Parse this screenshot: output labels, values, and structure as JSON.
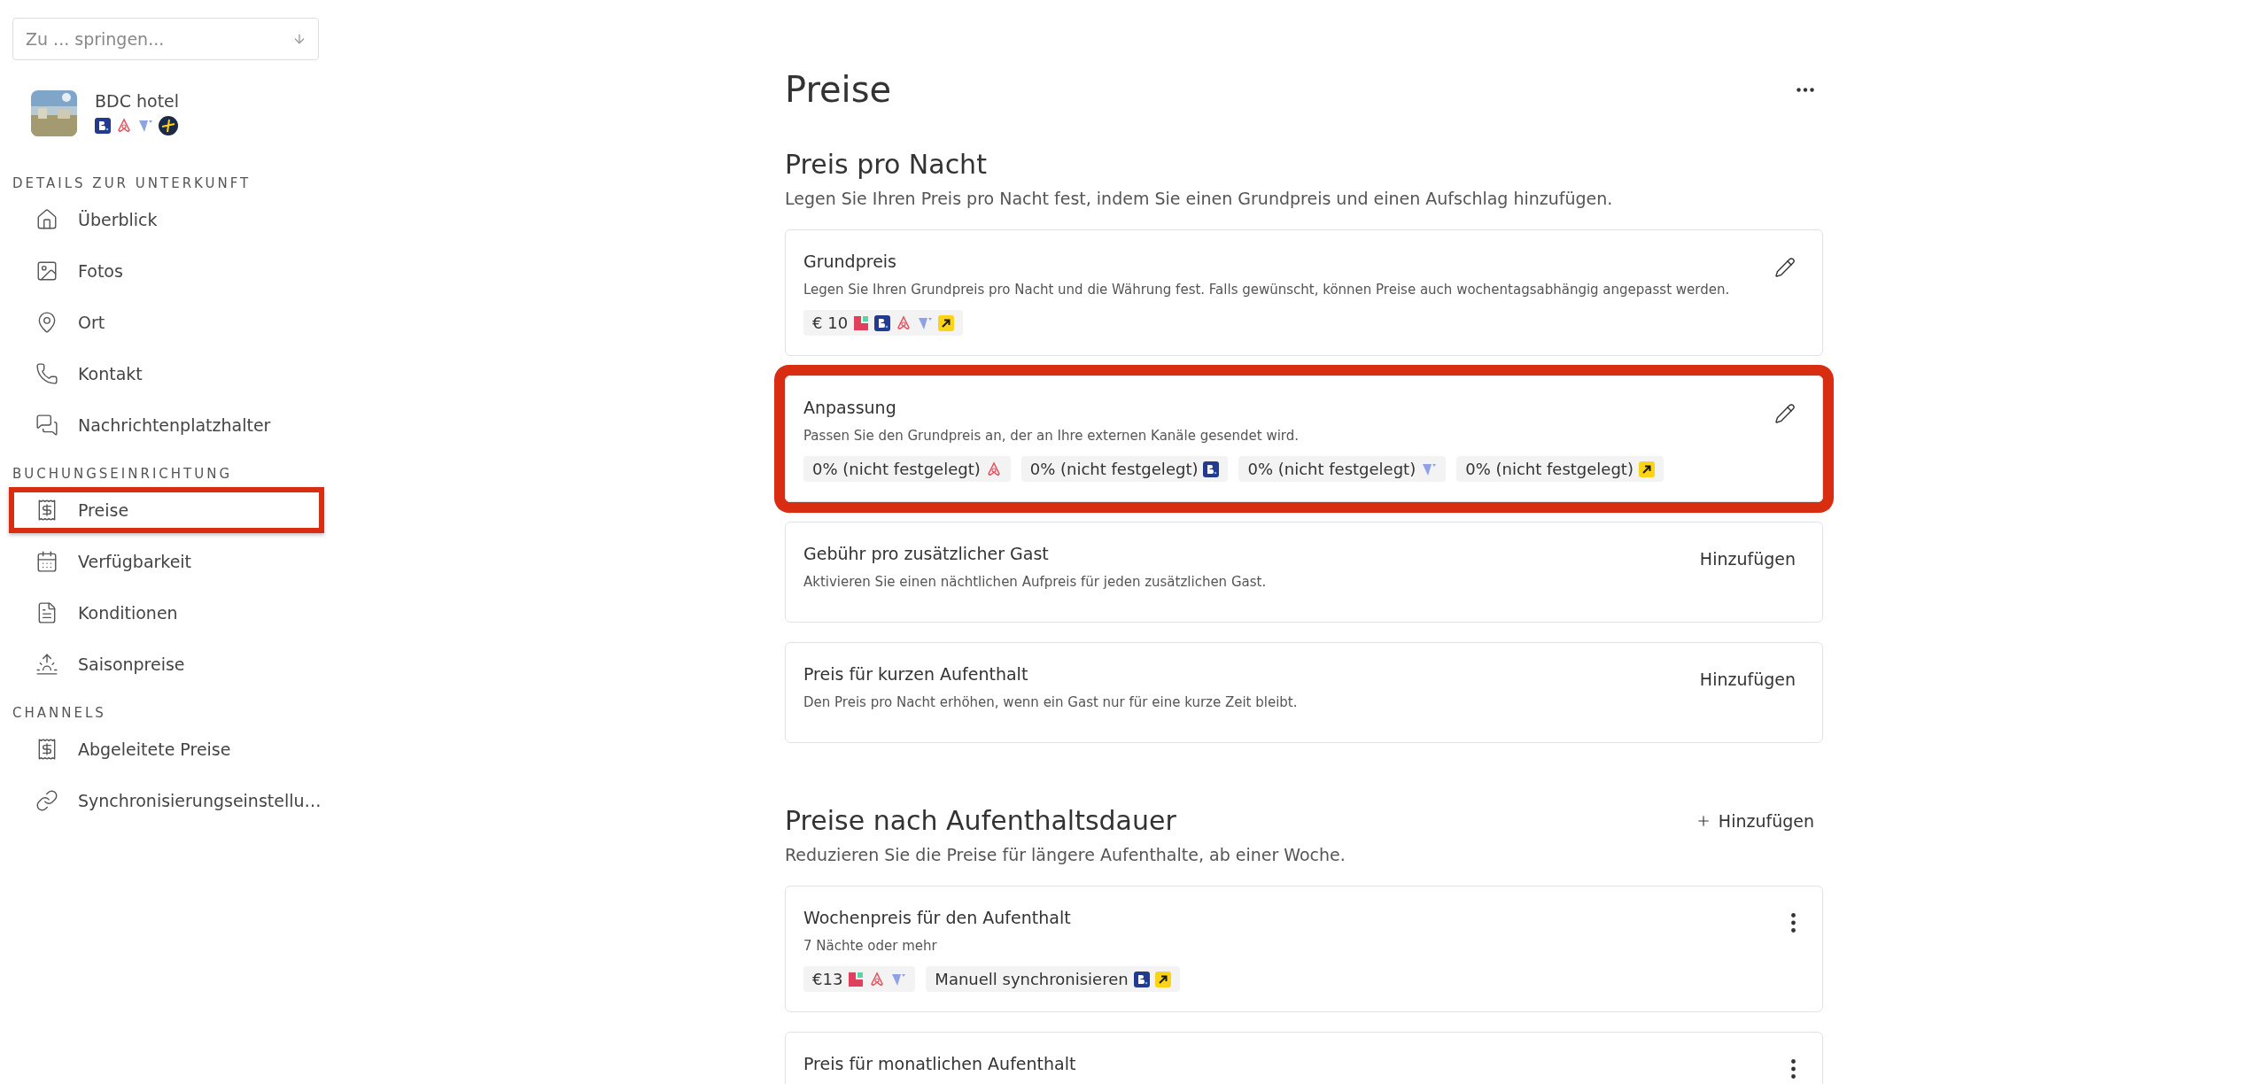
{
  "sidebar": {
    "jump": {
      "placeholder": "Zu ... springen..."
    },
    "property": {
      "name": "BDC hotel",
      "channels": [
        {
          "kind": "booking"
        },
        {
          "kind": "airbnb"
        },
        {
          "kind": "vrbo"
        },
        {
          "kind": "expedia_round"
        }
      ]
    },
    "sections": [
      {
        "title": "DETAILS ZUR UNTERKUNFT",
        "items": [
          {
            "label": "Überblick",
            "highlighted": false
          },
          {
            "label": "Fotos",
            "highlighted": false
          },
          {
            "label": "Ort",
            "highlighted": false
          },
          {
            "label": "Kontakt",
            "highlighted": false
          },
          {
            "label": "Nachrichtenplatzhalter",
            "highlighted": false
          }
        ]
      },
      {
        "title": "BUCHUNGSEINRICHTUNG",
        "items": [
          {
            "label": "Preise",
            "highlighted": true
          },
          {
            "label": "Verfügbarkeit",
            "highlighted": false
          },
          {
            "label": "Konditionen",
            "highlighted": false
          },
          {
            "label": "Saisonpreise",
            "highlighted": false
          }
        ]
      },
      {
        "title": "CHANNELS",
        "items": [
          {
            "label": "Abgeleitete Preise",
            "highlighted": false
          },
          {
            "label": "Synchronisierungseinstellu…",
            "highlighted": false
          }
        ]
      }
    ]
  },
  "page": {
    "title": "Preise",
    "sections": [
      {
        "title": "Preis pro Nacht",
        "description": "Legen Sie Ihren Preis pro Nacht fest, indem Sie einen Grundpreis und einen Aufschlag hinzufügen.",
        "cards": [
          {
            "kind": "edit",
            "title": "Grundpreis",
            "highlighted": false,
            "description": "Legen Sie Ihren Grundpreis pro Nacht und die Währung fest. Falls gewünscht, können Preise auch wochentagsabhängig angepasst werden.",
            "chips": [
              {
                "text": "€ 10",
                "channels": [
                  {
                    "kind": "pms"
                  },
                  {
                    "kind": "booking"
                  },
                  {
                    "kind": "airbnb"
                  },
                  {
                    "kind": "vrbo"
                  },
                  {
                    "kind": "expedia"
                  }
                ]
              }
            ]
          },
          {
            "kind": "edit",
            "title": "Anpassung",
            "highlighted": true,
            "description": "Passen Sie den Grundpreis an, der an Ihre externen Kanäle gesendet wird.",
            "chips": [
              {
                "text": "0% (nicht festgelegt)",
                "channels": [
                  {
                    "kind": "airbnb"
                  }
                ]
              },
              {
                "text": "0% (nicht festgelegt)",
                "channels": [
                  {
                    "kind": "booking"
                  }
                ]
              },
              {
                "text": "0% (nicht festgelegt)",
                "channels": [
                  {
                    "kind": "vrbo"
                  }
                ]
              },
              {
                "text": "0% (nicht festgelegt)",
                "channels": [
                  {
                    "kind": "expedia"
                  }
                ]
              }
            ]
          },
          {
            "kind": "add",
            "title": "Gebühr pro zusätzlicher Gast",
            "highlighted": false,
            "description": "Aktivieren Sie einen nächtlichen Aufpreis für jeden zusätzlichen Gast.",
            "action": "Hinzufügen"
          },
          {
            "kind": "add",
            "title": "Preis für kurzen Aufenthalt",
            "highlighted": false,
            "description": "Den Preis pro Nacht erhöhen, wenn ein Gast nur für eine kurze Zeit bleibt.",
            "action": "Hinzufügen"
          }
        ]
      },
      {
        "title": "Preise nach Aufenthaltsdauer",
        "description": "Reduzieren Sie die Preise für längere Aufenthalte, ab einer Woche.",
        "action": "Hinzufügen",
        "cards": [
          {
            "kind": "menu",
            "title": "Wochenpreis für den Aufenthalt",
            "highlighted": false,
            "description": "7 Nächte oder mehr",
            "chips": [
              {
                "text": "€13",
                "channels": [
                  {
                    "kind": "pms"
                  },
                  {
                    "kind": "airbnb"
                  },
                  {
                    "kind": "vrbo"
                  }
                ]
              },
              {
                "text": "Manuell synchronisieren",
                "channels": [
                  {
                    "kind": "booking"
                  },
                  {
                    "kind": "expedia"
                  }
                ]
              }
            ]
          },
          {
            "kind": "menu",
            "title": "Preis für monatlichen Aufenthalt",
            "highlighted": false
          }
        ]
      }
    ]
  }
}
